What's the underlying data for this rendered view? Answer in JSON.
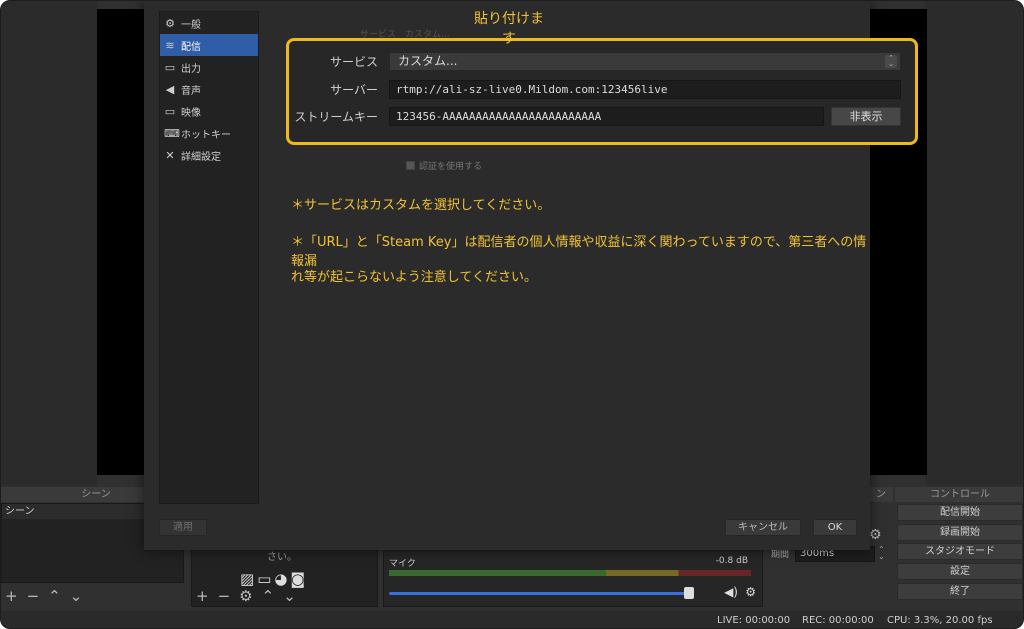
{
  "annotation": {
    "title": "貼り付けます",
    "notes": [
      "＊サービスはカスタムを選択してください。",
      "＊「URL」と「Steam Key」は配信者の個人情報や収益に深く関わっていますので、第三者への情報漏",
      "れ等が起こらないよう注意してください。"
    ]
  },
  "settings": {
    "nav": [
      {
        "icon": "gear-icon",
        "glyph": "⚙",
        "label": "一般"
      },
      {
        "icon": "broadcast-icon",
        "glyph": "≋",
        "label": "配信"
      },
      {
        "icon": "output-icon",
        "glyph": "▭",
        "label": "出力"
      },
      {
        "icon": "speaker-icon",
        "glyph": "◀",
        "label": "音声"
      },
      {
        "icon": "monitor-icon",
        "glyph": "▭",
        "label": "映像"
      },
      {
        "icon": "keyboard-icon",
        "glyph": "⌨",
        "label": "ホットキー"
      },
      {
        "icon": "tools-icon",
        "glyph": "✕",
        "label": "詳細設定"
      }
    ],
    "active_nav": "配信",
    "ghost_service_text": "サービス　カスタム...",
    "service": {
      "label": "サービス",
      "value": "カスタム..."
    },
    "server": {
      "label": "サーバー",
      "value": "rtmp://ali-sz-live0.Mildom.com:123456live"
    },
    "stream_key": {
      "label": "ストリームキー",
      "value": "123456-AAAAAAAAAAAAAAAAAAAAAAAA",
      "button": "非表示"
    },
    "auth_checkbox": "認証を使用する",
    "apply": "適用",
    "cancel": "キャンセル",
    "ok": "OK"
  },
  "obs": {
    "scenes_header": "シーン",
    "scenes_list_head": "シーン",
    "sources_fragment": "さい。",
    "controls_header": "コントロール",
    "transition_header_fragment": "ン",
    "controls": [
      "配信開始",
      "録画開始",
      "スタジオモード",
      "設定",
      "終了"
    ],
    "mixer": {
      "label": "マイク",
      "db": "-0.8 dB"
    },
    "transition_duration_label": "期間",
    "transition_duration": "300ms",
    "status": {
      "live": "LIVE: 00:00:00",
      "rec": "REC: 00:00:00",
      "cpu": "CPU: 3.3%, 20.00 fps"
    }
  }
}
